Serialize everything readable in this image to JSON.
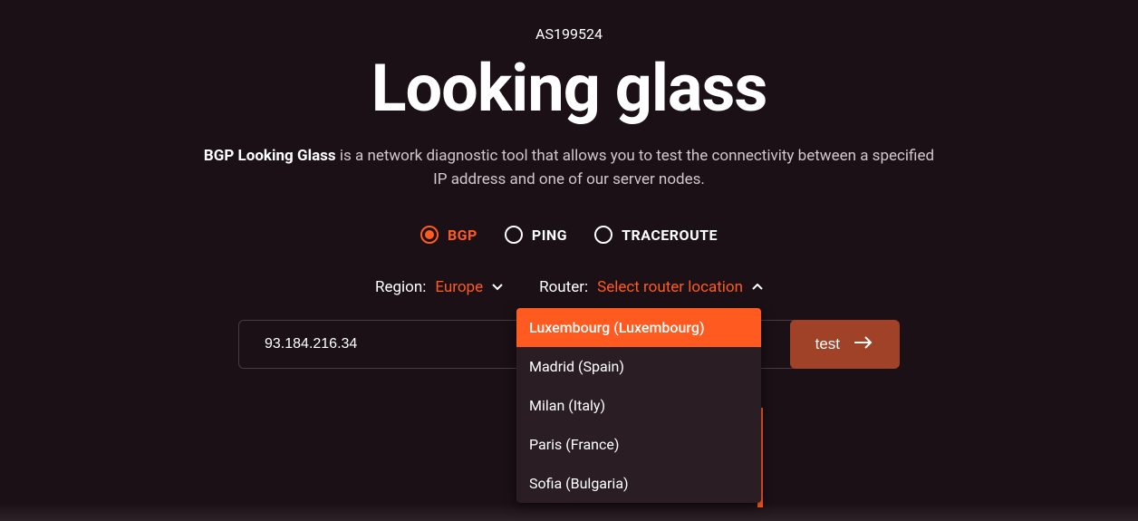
{
  "header": {
    "as_number": "AS199524",
    "title": "Looking glass",
    "description_bold": "BGP Looking Glass",
    "description_rest": " is a network diagnostic tool that allows you to test the connectivity between a specified IP address and one of our server nodes."
  },
  "radio_options": {
    "bgp": "BGP",
    "ping": "PING",
    "traceroute": "TRACEROUTE"
  },
  "selectors": {
    "region_label": "Region:",
    "region_value": "Europe",
    "router_label": "Router:",
    "router_value": "Select router location"
  },
  "dropdown": {
    "items": [
      "Luxembourg (Luxembourg)",
      "Madrid (Spain)",
      "Milan (Italy)",
      "Paris (France)",
      "Sofia (Bulgaria)"
    ]
  },
  "input": {
    "ip_value": "93.184.216.34"
  },
  "button": {
    "run_label": "test"
  }
}
